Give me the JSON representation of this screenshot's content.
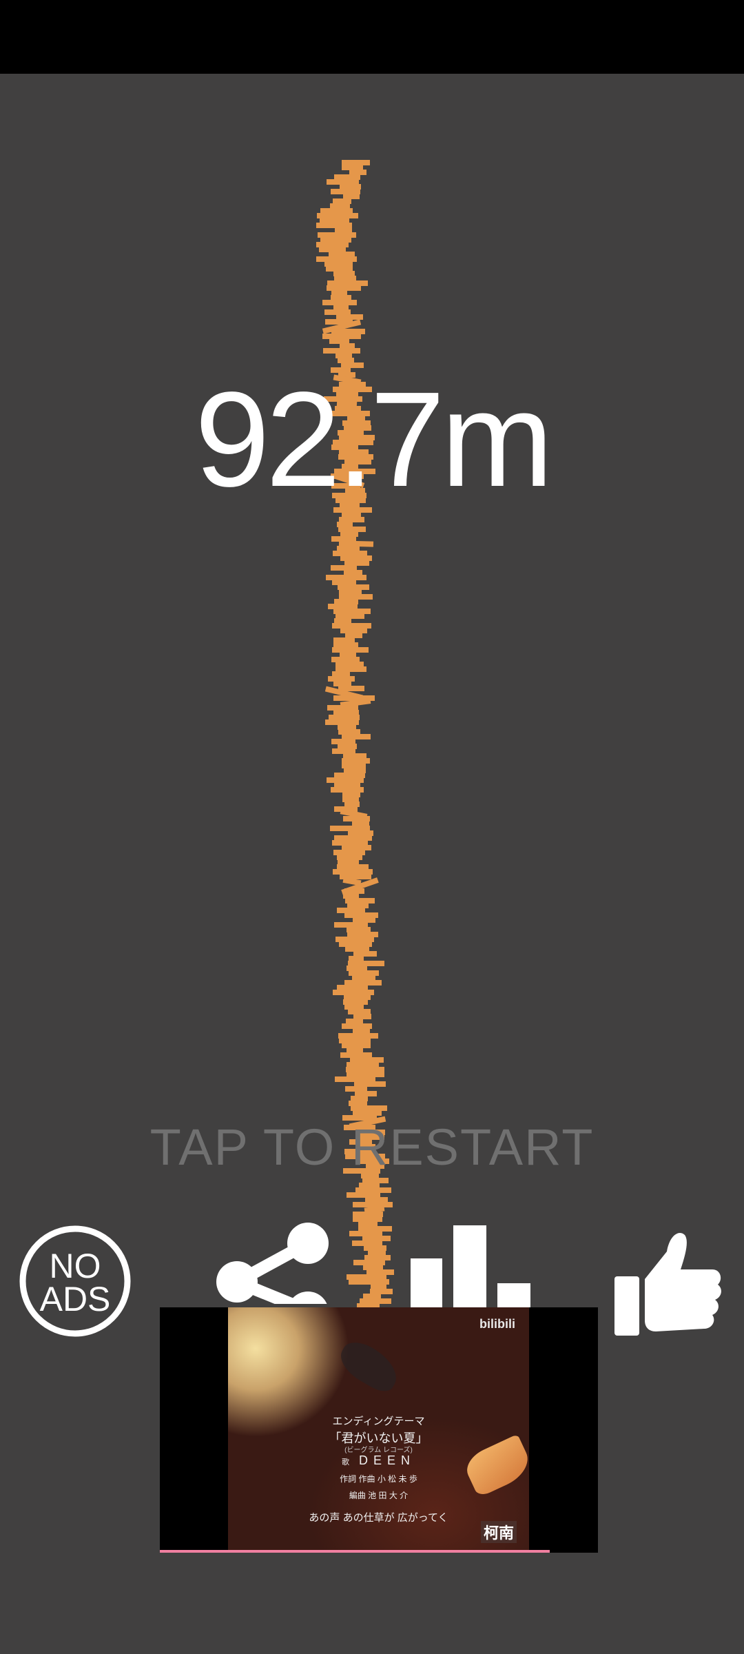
{
  "game": {
    "score": "92.7m",
    "restart_prompt": "TAP TO RESTART",
    "tower_color": "#e5974a",
    "background_color": "#414040"
  },
  "buttons": {
    "no_ads": {
      "line1": "NO",
      "line2": "ADS",
      "icon": "no-ads-icon"
    },
    "share": {
      "icon": "share-icon"
    },
    "leaderboard": {
      "icon": "bar-chart-icon"
    },
    "like": {
      "icon": "thumbs-up-icon"
    }
  },
  "ad_video": {
    "logo": "bilibili",
    "caption_title": "エンディングテーマ",
    "caption_song": "「君がいない夏」",
    "caption_label": "(ビーグラム レコーズ)",
    "caption_artist_prefix": "歌",
    "caption_artist": "DEEN",
    "caption_writer": "作詞 作曲  小 松 未 歩",
    "caption_arranger": "編曲  池 田 大 介",
    "caption_lyric": "あの声   あの仕草が   広がってく",
    "sticker": "柯南",
    "progress": 0.89
  }
}
